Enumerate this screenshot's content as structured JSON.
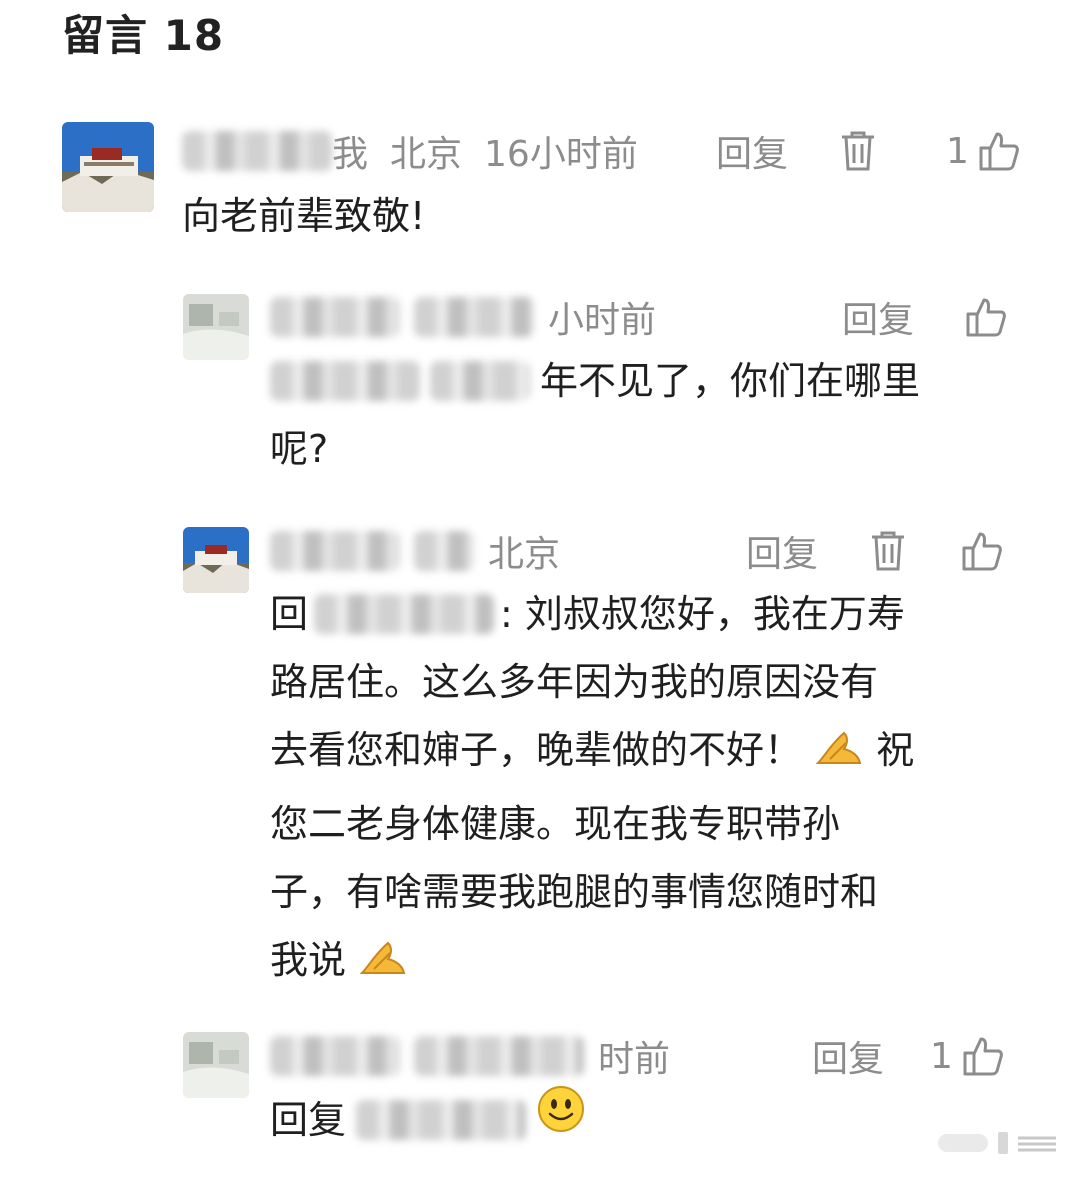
{
  "header": {
    "title": "留言 18"
  },
  "comments": [
    {
      "author_tail": "我",
      "location": "北京",
      "time": "16小时前",
      "reply_label": "回复",
      "like_count": "1",
      "text": "向老前辈致敬!",
      "avatar": "potala-palace-avatar"
    },
    {
      "time": "小时前",
      "reply_label": "回复",
      "text_line1": "年不见了，你们在哪里",
      "text_line2": "呢?",
      "avatar": "snow-landscape-avatar"
    },
    {
      "location": "北京",
      "reply_label": "回复",
      "text_prefix": "回",
      "text_after_mention": ": 刘叔叔您好，我在万寿",
      "text_line2": "路居住。这么多年因为我的原因没有",
      "text_line3": "去看您和婶子，晚辈做的不好！",
      "text_line3_tail": "祝",
      "text_line4": "您二老身体健康。现在我专职带孙",
      "text_line5": "子，有啥需要我跑腿的事情您随时和",
      "text_line6": "我说",
      "avatar": "potala-palace-avatar"
    },
    {
      "time": "时前",
      "reply_label": "回复",
      "like_count": "1",
      "text_prefix": "回复",
      "avatar": "snow-landscape-avatar"
    }
  ],
  "icons": {
    "delete": "trash-icon",
    "like": "thumbs-up-icon",
    "emoji_pray": "folded-hands-emoji",
    "emoji_smile": "smiling-face-emoji"
  },
  "colors": {
    "text": "#1f1f1f",
    "meta": "#8c8c8c",
    "background": "#ffffff"
  }
}
